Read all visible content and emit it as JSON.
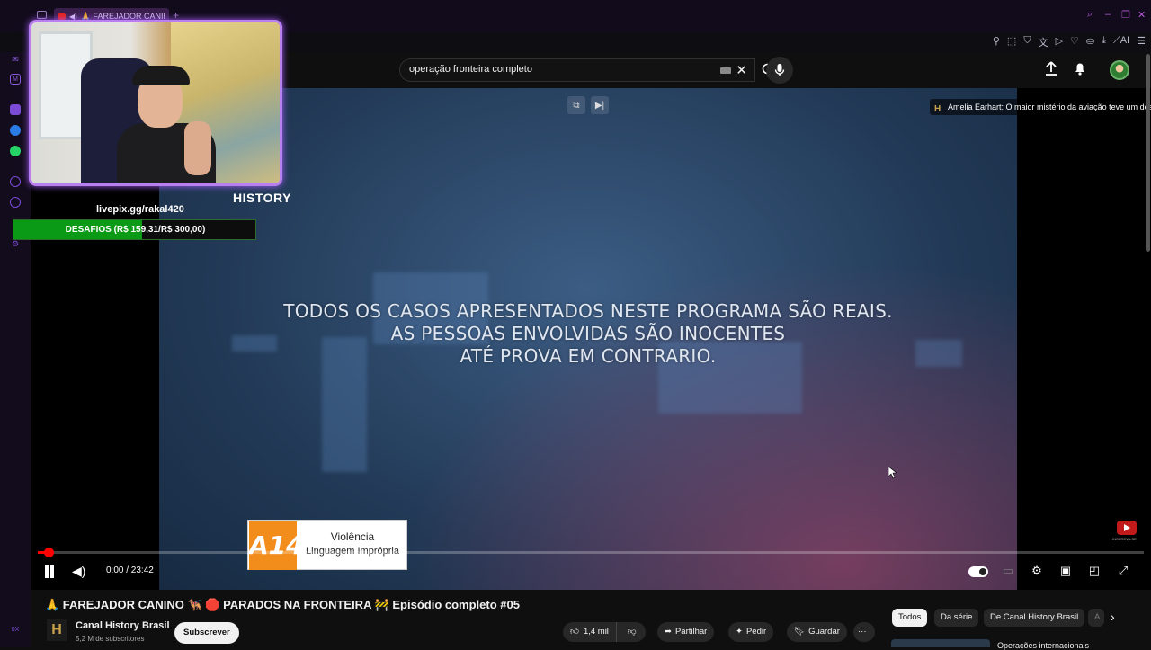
{
  "browser": {
    "tab_label": "🙏 FAREJADOR CANINO",
    "new_tab": "+",
    "toolbar_icons": [
      "pin-icon",
      "screenshot-icon",
      "shield-icon",
      "translate-icon",
      "send-icon",
      "heart-icon",
      "wallet-icon",
      "download-icon",
      "ai-icon",
      "menu-icon"
    ],
    "ai_label": "AI",
    "sidebar_bottom_label": "0X"
  },
  "header": {
    "search_value": "operação fronteira completo"
  },
  "player": {
    "disclaimer_lines": [
      "TODOS OS CASOS APRESENTADOS NESTE PROGRAMA SÃO REAIS.",
      "AS PESSOAS ENVOLVIDAS SÃO INOCENTES",
      "ATÉ PROVA EM CONTRARIO."
    ],
    "watermark": "HISTORY",
    "endscreen_title": "Amelia Earhart: O maior mistério da aviação teve um desfec",
    "endscreen_logo": "H",
    "rating": {
      "badge": "A14",
      "line1": "Violência",
      "line2": "Linguagem Imprópria"
    },
    "time": "0:00 / 23:42",
    "progress_fraction": 0.01,
    "watermark_small": "INSCREVA-SE"
  },
  "overlay": {
    "livepix": "livepix.gg/rakal420",
    "goal_text": "DESAFIOS (R$ 159,31/R$ 300,00)",
    "goal_fraction": 0.531
  },
  "below": {
    "title": "🙏 FAREJADOR CANINO 🐕‍🦺 🛑 PARADOS NA FRONTEIRA 🚧 Episódio completo #05",
    "channel_logo": "H",
    "channel_name": "Canal History Brasil",
    "subscribers": "5,2 M de subscritores",
    "subscribe": "Subscrever",
    "likes": "1,4 mil",
    "share": "Partilhar",
    "ask": "Pedir",
    "save": "Guardar",
    "more": "···",
    "chips": [
      "Todos",
      "Da série",
      "De Canal History Brasil",
      "A"
    ],
    "related_title": "Operações internacionais"
  }
}
